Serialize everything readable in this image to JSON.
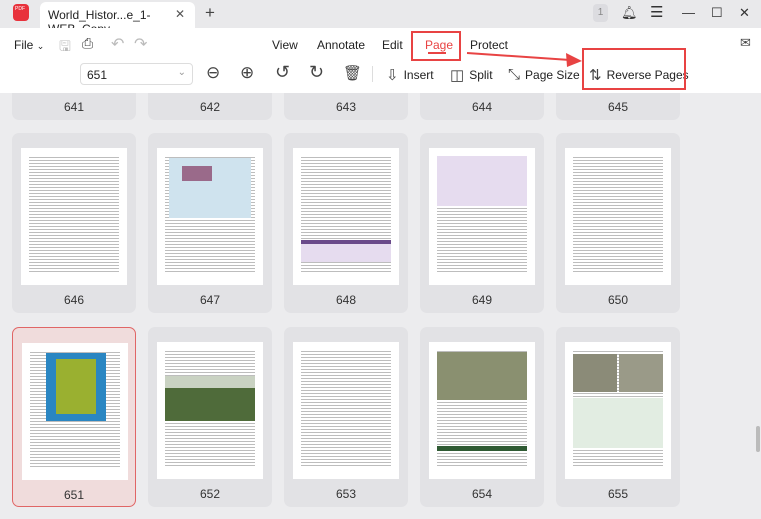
{
  "tab": {
    "title": "World_Histor...e_1-WEB_Copy",
    "close": "✕",
    "new": "+"
  },
  "window": {
    "notifications_count": "1"
  },
  "menu": {
    "file": "File",
    "view": "View",
    "annotate": "Annotate",
    "edit": "Edit",
    "page": "Page",
    "protect": "Protect"
  },
  "page_toolbar": {
    "page_number": "651",
    "insert": "Insert",
    "split": "Split",
    "page_size": "Page Size",
    "reverse_pages": "Reverse Pages"
  },
  "accent_color": "#e84343",
  "top_row": [
    "641",
    "642",
    "643",
    "644",
    "645"
  ],
  "rows": [
    {
      "pages": [
        {
          "n": "646",
          "type": "text"
        },
        {
          "n": "647",
          "type": "map"
        },
        {
          "n": "648",
          "type": "purple-box"
        },
        {
          "n": "649",
          "type": "purple-box-top"
        },
        {
          "n": "650",
          "type": "text"
        }
      ]
    },
    {
      "pages": [
        {
          "n": "651",
          "type": "africa-map",
          "selected": true
        },
        {
          "n": "652",
          "type": "landscape"
        },
        {
          "n": "653",
          "type": "text"
        },
        {
          "n": "654",
          "type": "photo-green"
        },
        {
          "n": "655",
          "type": "photos-green-box"
        }
      ]
    }
  ]
}
